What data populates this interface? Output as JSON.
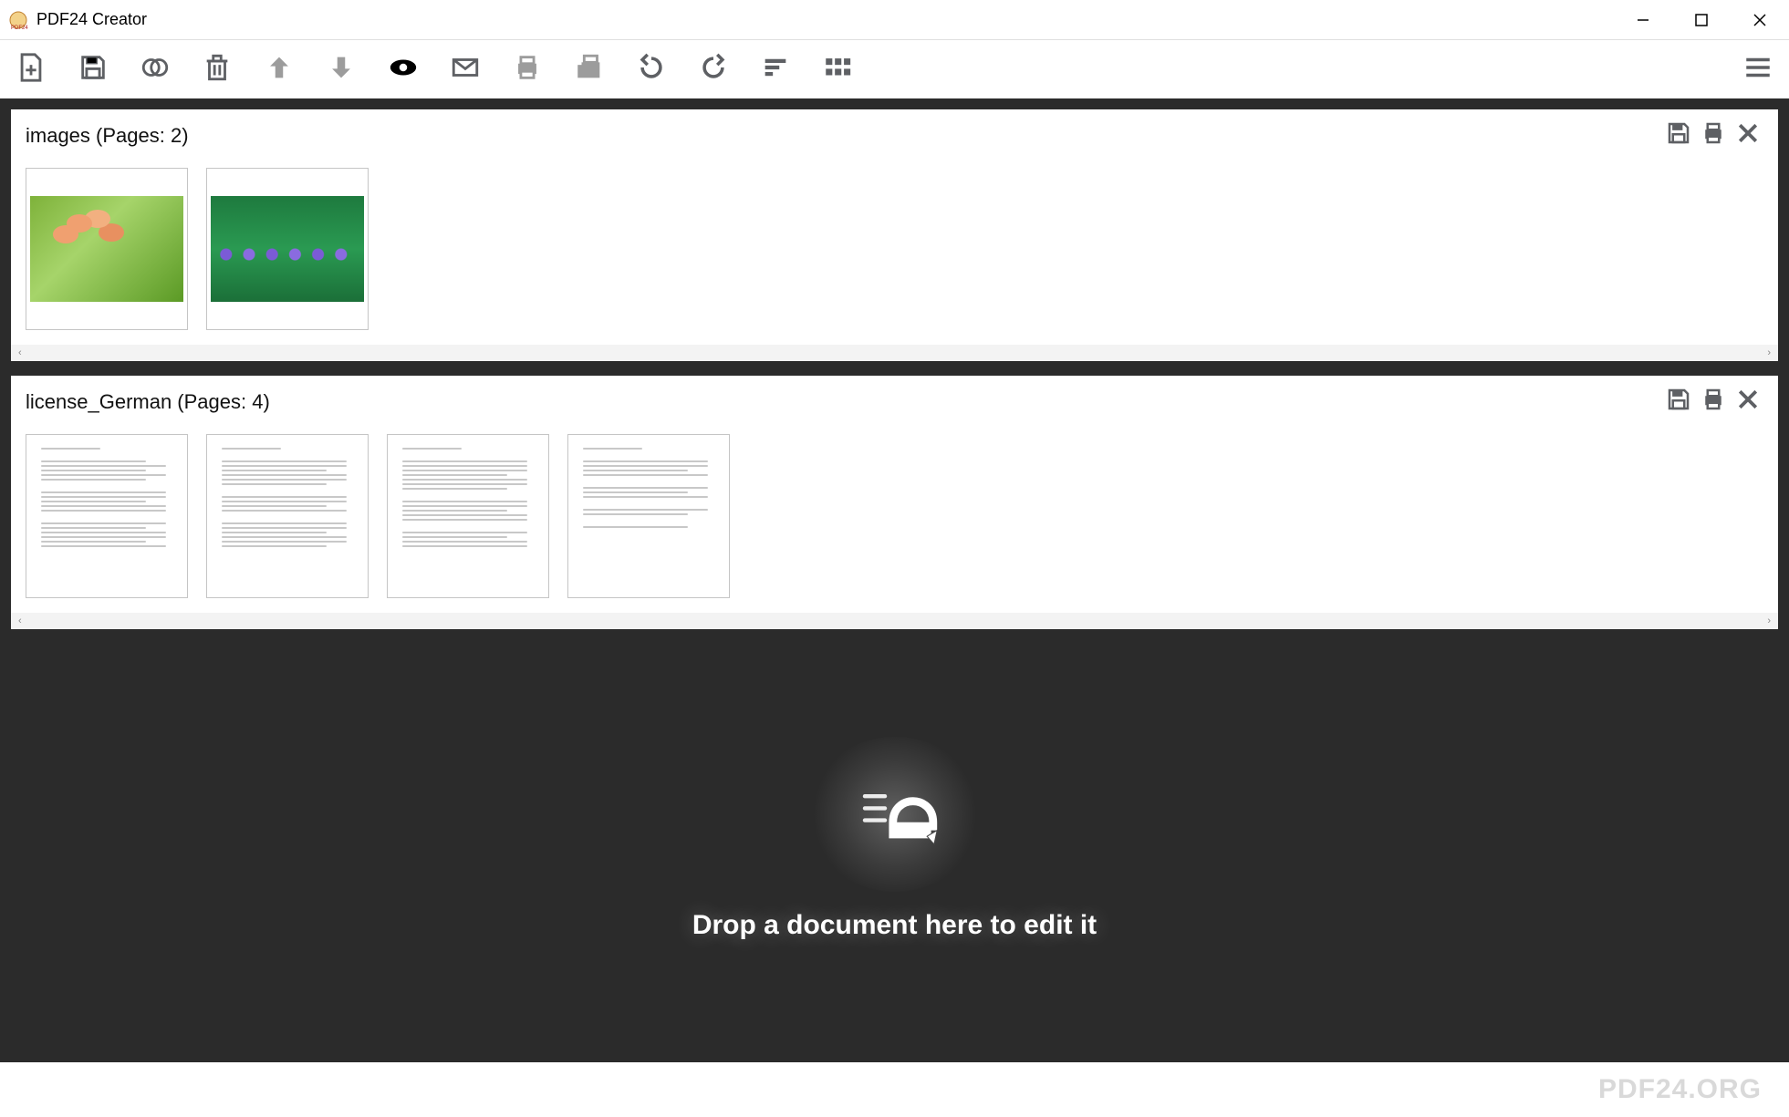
{
  "titlebar": {
    "app_name": "PDF24 Creator"
  },
  "toolbar": {
    "items": [
      {
        "name": "add-file-button",
        "icon": "file-plus-icon"
      },
      {
        "name": "save-button",
        "icon": "save-icon"
      },
      {
        "name": "merge-button",
        "icon": "merge-icon"
      },
      {
        "name": "delete-button",
        "icon": "trash-icon"
      },
      {
        "name": "move-up-button",
        "icon": "arrow-up-icon"
      },
      {
        "name": "move-down-button",
        "icon": "arrow-down-icon"
      },
      {
        "name": "preview-button",
        "icon": "eye-icon"
      },
      {
        "name": "email-button",
        "icon": "mail-icon"
      },
      {
        "name": "print-button",
        "icon": "print-icon"
      },
      {
        "name": "fax-button",
        "icon": "fax-icon"
      },
      {
        "name": "rotate-left-button",
        "icon": "rotate-left-icon"
      },
      {
        "name": "rotate-right-button",
        "icon": "rotate-right-icon"
      },
      {
        "name": "sort-button",
        "icon": "sort-icon"
      },
      {
        "name": "grid-button",
        "icon": "grid-icon"
      }
    ],
    "menu": {
      "name": "hamburger-menu",
      "icon": "hamburger-icon"
    }
  },
  "documents": [
    {
      "title": "images (Pages: 2)",
      "pages": 2,
      "type": "images",
      "thumb_kinds": [
        "flower1",
        "flower2"
      ]
    },
    {
      "title": "license_German (Pages: 4)",
      "pages": 4,
      "type": "text",
      "thumb_kinds": [
        "text",
        "text",
        "text",
        "text"
      ]
    }
  ],
  "dropzone": {
    "label": "Drop a document here to edit it"
  },
  "footer": {
    "brand": "PDF24.ORG"
  }
}
